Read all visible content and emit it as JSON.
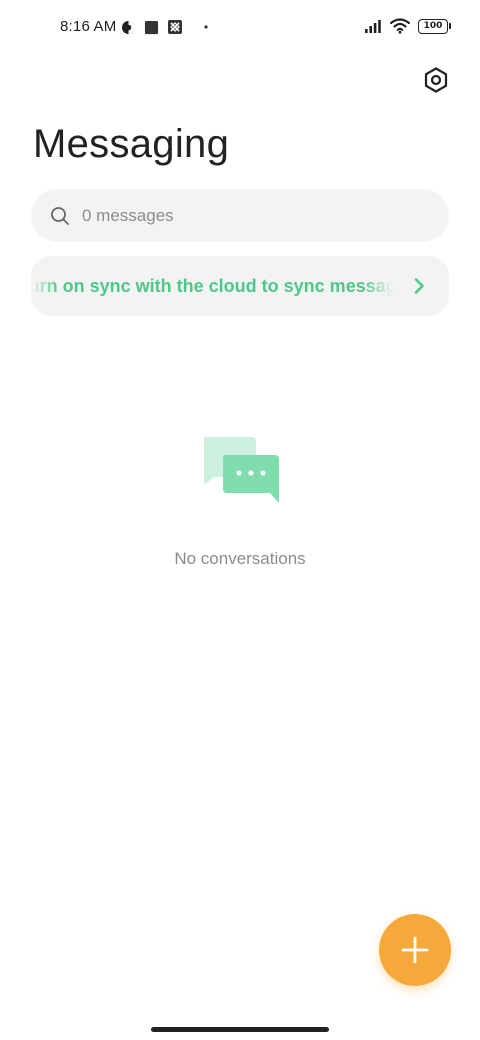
{
  "status_bar": {
    "time": "8:16 AM",
    "battery": "100",
    "left_icons": [
      "data-saver-icon",
      "square-notification-icon",
      "screen-icon",
      "dot-icon"
    ],
    "right_icons": [
      "signal-icon",
      "wifi-icon",
      "battery-icon"
    ]
  },
  "header": {
    "title": "Messaging",
    "settings_icon": "settings-icon"
  },
  "search": {
    "placeholder": "0 messages"
  },
  "sync_banner": {
    "text": "Turn on sync with the cloud to sync messages"
  },
  "empty_state": {
    "text": "No conversations"
  },
  "fab": {
    "icon": "plus-icon",
    "color": "#f5a93a"
  },
  "colors": {
    "accent_green": "#4cc88a",
    "fab_orange": "#f5a93a"
  }
}
